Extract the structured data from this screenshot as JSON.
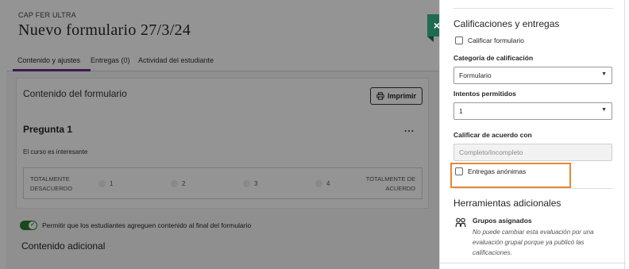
{
  "header": {
    "course_code": "CAP FER ULTRA",
    "title": "Nuevo formulario 27/3/24"
  },
  "tabs": [
    {
      "label": "Contenido y ajustes",
      "active": true
    },
    {
      "label": "Entregas (0)",
      "active": false
    },
    {
      "label": "Actividad del estudiante",
      "active": false
    }
  ],
  "content": {
    "section_title": "Contenido del formulario",
    "print_label": "Imprimir",
    "question": {
      "title": "Pregunta 1",
      "menu": "...",
      "text": "El curso es interesante",
      "scale_left": [
        "TOTALMENTE",
        "DESACUERDO"
      ],
      "scale_right": [
        "TOTALMENTE DE",
        "ACUERDO"
      ],
      "options": [
        "1",
        "2",
        "3",
        "4"
      ]
    },
    "allow_toggle_label": "Permitir que los estudiantes agreguen contenido al final del formulario",
    "allow_toggle_on": true,
    "extra_title": "Contenido adicional"
  },
  "panel": {
    "close_label": "×",
    "section1_title": "Calificaciones y entregas",
    "grade_form_label": "Calificar formulario",
    "grade_category_label": "Categoría de calificación",
    "grade_category_value": "Formulario",
    "attempts_label": "Intentos permitidos",
    "attempts_value": "1",
    "grade_by_label": "Calificar de acuerdo con",
    "grade_by_value": "Completo/Incompleto",
    "anonymous_label": "Entregas anónimas",
    "section2_title": "Herramientas adicionales",
    "groups_title": "Grupos asignados",
    "groups_note": "No puede cambiar esta evaluación por una evaluación grupal porque ya publicó las calificaciones."
  },
  "colors": {
    "accent_purple": "#6a2a8f",
    "close_green": "#1e6b52",
    "toggle_green": "#2e7d32",
    "highlight_orange": "#e5873a"
  },
  "icons": [
    "printer-icon",
    "close-icon",
    "chevron-down-icon",
    "group-icon",
    "check-icon"
  ]
}
